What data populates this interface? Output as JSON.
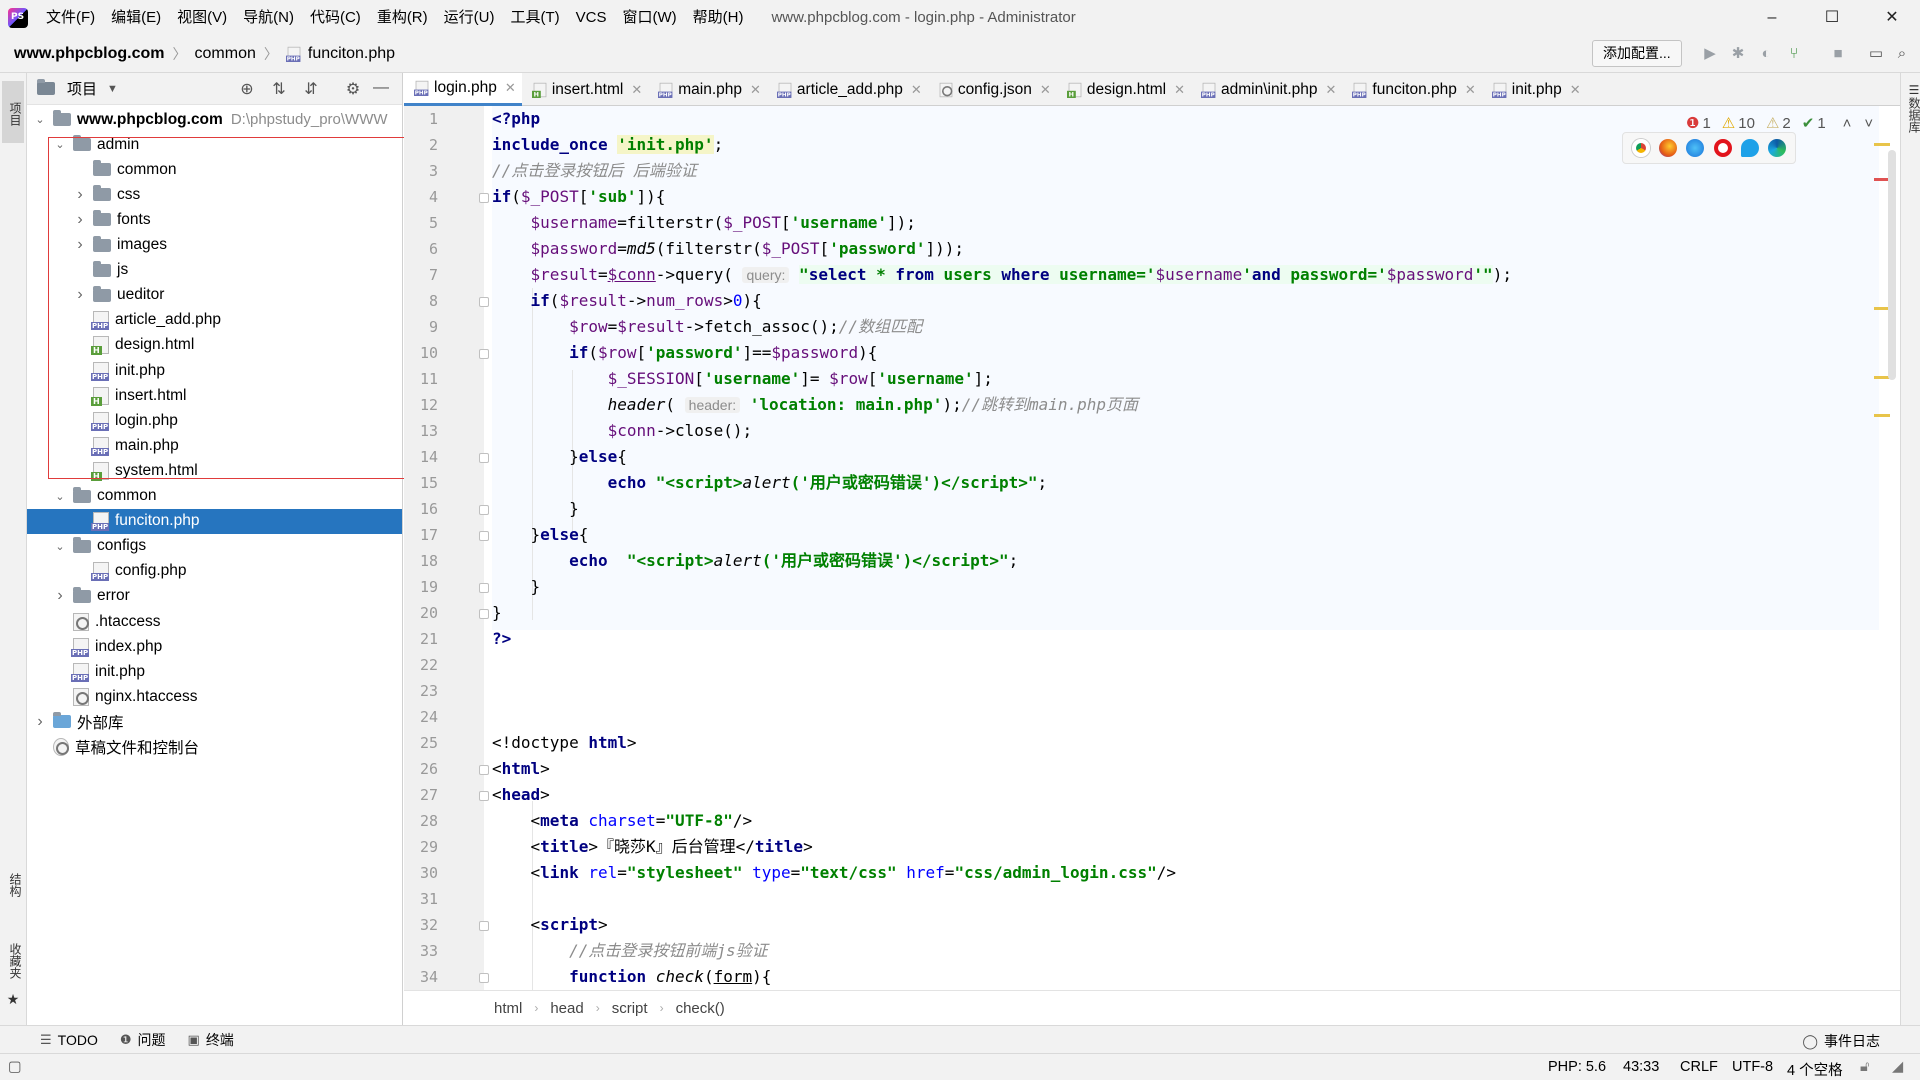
{
  "window": {
    "title": "www.phpcblog.com - login.php - Administrator",
    "controls": {
      "minimize": "–",
      "maximize": "☐",
      "close": "✕"
    }
  },
  "menu": [
    "文件(F)",
    "编辑(E)",
    "视图(V)",
    "导航(N)",
    "代码(C)",
    "重构(R)",
    "运行(U)",
    "工具(T)",
    "VCS",
    "窗口(W)",
    "帮助(H)"
  ],
  "navbar": {
    "crumbs": [
      "www.phpcblog.com",
      "common",
      "funciton.php"
    ],
    "config_button": "添加配置..."
  },
  "left_strip": {
    "project": "项目",
    "structure": "结构",
    "favorites": "收藏夹"
  },
  "right_strip": {
    "database": "数据库"
  },
  "project_panel": {
    "title": "项目",
    "root_name": "www.phpcblog.com",
    "root_path": "D:\\phpstudy_pro\\WWW",
    "items": [
      {
        "label": "admin",
        "type": "folder",
        "depth": 1,
        "arrow": "open"
      },
      {
        "label": "common",
        "type": "folder",
        "depth": 2,
        "arrow": "none"
      },
      {
        "label": "css",
        "type": "folder",
        "depth": 2,
        "arrow": "closed"
      },
      {
        "label": "fonts",
        "type": "folder",
        "depth": 2,
        "arrow": "closed"
      },
      {
        "label": "images",
        "type": "folder",
        "depth": 2,
        "arrow": "closed"
      },
      {
        "label": "js",
        "type": "folder",
        "depth": 2,
        "arrow": "none"
      },
      {
        "label": "ueditor",
        "type": "folder",
        "depth": 2,
        "arrow": "closed"
      },
      {
        "label": "article_add.php",
        "type": "php",
        "depth": 2
      },
      {
        "label": "design.html",
        "type": "html",
        "depth": 2
      },
      {
        "label": "init.php",
        "type": "php",
        "depth": 2
      },
      {
        "label": "insert.html",
        "type": "html",
        "depth": 2
      },
      {
        "label": "login.php",
        "type": "php",
        "depth": 2
      },
      {
        "label": "main.php",
        "type": "php",
        "depth": 2
      },
      {
        "label": "system.html",
        "type": "html",
        "depth": 2
      },
      {
        "label": "common",
        "type": "folder",
        "depth": 1,
        "arrow": "open"
      },
      {
        "label": "funciton.php",
        "type": "php",
        "depth": 2,
        "selected": true
      },
      {
        "label": "configs",
        "type": "folder",
        "depth": 1,
        "arrow": "open"
      },
      {
        "label": "config.php",
        "type": "php",
        "depth": 2
      },
      {
        "label": "error",
        "type": "folder",
        "depth": 1,
        "arrow": "closed"
      },
      {
        "label": ".htaccess",
        "type": "cfg",
        "depth": 1
      },
      {
        "label": "index.php",
        "type": "php",
        "depth": 1
      },
      {
        "label": "init.php",
        "type": "php",
        "depth": 1
      },
      {
        "label": "nginx.htaccess",
        "type": "cfg",
        "depth": 1
      },
      {
        "label": "外部库",
        "type": "lib",
        "depth": 0,
        "arrow": "closed"
      },
      {
        "label": "草稿文件和控制台",
        "type": "scratch",
        "depth": 0
      }
    ]
  },
  "tabs": [
    {
      "label": "login.php",
      "type": "php",
      "active": true
    },
    {
      "label": "insert.html",
      "type": "html"
    },
    {
      "label": "main.php",
      "type": "php"
    },
    {
      "label": "article_add.php",
      "type": "php"
    },
    {
      "label": "config.json",
      "type": "cfg"
    },
    {
      "label": "design.html",
      "type": "html"
    },
    {
      "label": "admin\\init.php",
      "type": "php"
    },
    {
      "label": "funciton.php",
      "type": "php"
    },
    {
      "label": "init.php",
      "type": "php"
    }
  ],
  "inspections": {
    "errors": "1",
    "warnings": "10",
    "weak_warnings": "2",
    "typos": "1"
  },
  "line_numbers": [
    "1",
    "2",
    "3",
    "4",
    "5",
    "6",
    "7",
    "8",
    "9",
    "10",
    "11",
    "12",
    "13",
    "14",
    "15",
    "16",
    "17",
    "18",
    "19",
    "20",
    "21",
    "22",
    "23",
    "24",
    "25",
    "26",
    "27",
    "28",
    "29",
    "30",
    "31",
    "32",
    "33",
    "34"
  ],
  "code_breadcrumb": [
    "html",
    "head",
    "script",
    "check()"
  ],
  "tool_windows": {
    "todo": "TODO",
    "problems": "问题",
    "terminal": "终端",
    "event_log": "事件日志"
  },
  "status": {
    "php": "PHP: 5.6",
    "position": "43:33",
    "line_sep": "CRLF",
    "encoding": "UTF-8",
    "indent": "4 个空格"
  },
  "colors": {
    "selection": "#2675bf",
    "keyword": "#000080",
    "string": "#008000",
    "comment": "#8c8c8c",
    "variable": "#660e7a",
    "annotation_box": "#e03b3b"
  }
}
